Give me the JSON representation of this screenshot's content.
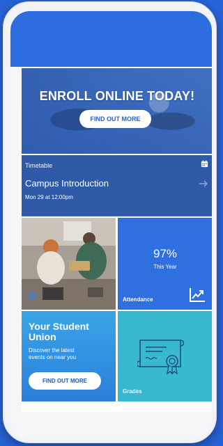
{
  "promo": {
    "title": "ENROLL ONLINE TODAY!",
    "button_label": "FIND OUT MORE"
  },
  "timetable": {
    "label": "Timetable",
    "event_title": "Campus Introduction",
    "event_time": "Mon 29 at 12:00pm",
    "calendar_icon": "calendar-icon",
    "arrow_icon": "arrow-right-icon"
  },
  "attendance": {
    "value": "97%",
    "period": "This Year",
    "label": "Attendance",
    "icon": "trending-up-icon"
  },
  "union": {
    "title": "Your Student Union",
    "description": "Discover the latest events on near you",
    "button_label": "FIND OUT MORE"
  },
  "grades": {
    "label": "Grades",
    "icon": "certificate-icon"
  },
  "colors": {
    "background": "#2764d9",
    "header": "#2d6de0",
    "timetable": "#2f5aa8",
    "attendance": "#2f6fe0",
    "union": "#3aa4e6",
    "grades": "#39b8d2"
  }
}
